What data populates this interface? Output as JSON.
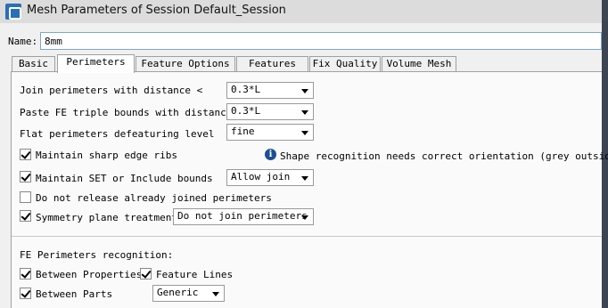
{
  "window": {
    "title": "Mesh Parameters of Session Default_Session"
  },
  "name": {
    "label": "Name:",
    "value": "8mm"
  },
  "tabs": [
    {
      "label": "Basic"
    },
    {
      "label": "Perimeters"
    },
    {
      "label": "Feature Options"
    },
    {
      "label": "Features"
    },
    {
      "label": "Fix Quality"
    },
    {
      "label": "Volume Mesh"
    }
  ],
  "perimeters": {
    "join_distance": {
      "label": "Join perimeters with distance <",
      "value": "0.3*L"
    },
    "paste_distance": {
      "label": "Paste FE triple bounds with distance <",
      "value": "0.3*L"
    },
    "flat_level": {
      "label": "Flat perimeters defeaturing level",
      "value": "fine"
    },
    "sharp_edge": {
      "label": "Maintain sharp edge ribs",
      "checked": true
    },
    "info_text": "Shape recognition needs correct orientation (grey outside).",
    "maintain_set": {
      "label": "Maintain SET or Include bounds",
      "checked": true,
      "value": "Allow join"
    },
    "no_release": {
      "label": "Do not release already joined perimeters",
      "checked": false
    },
    "symmetry": {
      "label": "Symmetry plane treatment",
      "checked": true,
      "value": "Do not join perimeters"
    }
  },
  "fe_recognition": {
    "heading": "FE Perimeters recognition:",
    "between_properties": {
      "label": "Between Properties",
      "checked": true
    },
    "feature_lines": {
      "label": "Feature Lines",
      "checked": true
    },
    "between_parts": {
      "label": "Between Parts",
      "checked": true,
      "value": "Generic"
    }
  }
}
